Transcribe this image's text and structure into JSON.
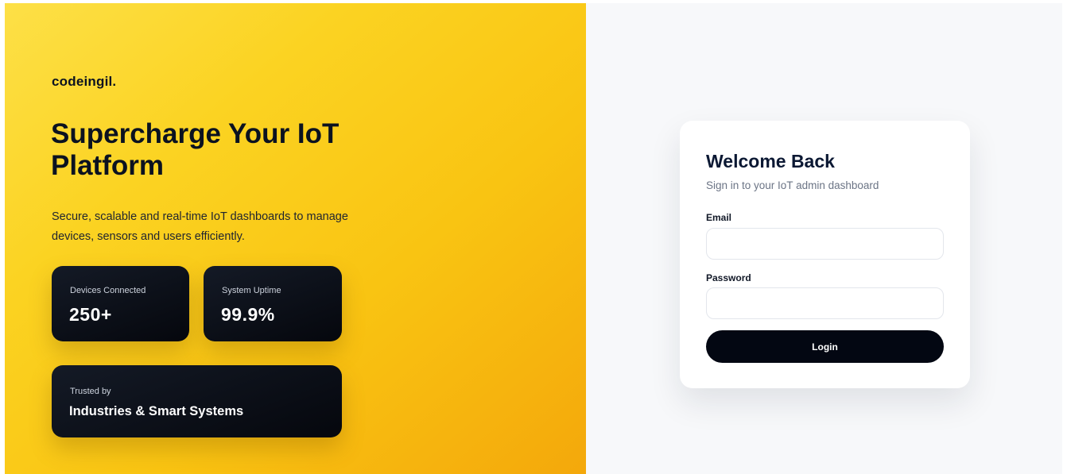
{
  "hero": {
    "brand": "codeingil.",
    "title": "Supercharge Your IoT Platform",
    "subtitle": "Secure, scalable and real-time IoT dashboards to manage devices, sensors and users efficiently.",
    "stats": [
      {
        "label": "Devices Connected",
        "value": "250+"
      },
      {
        "label": "System Uptime",
        "value": "99.9%"
      }
    ],
    "trusted": {
      "label": "Trusted by",
      "value": "Industries & Smart Systems"
    }
  },
  "login": {
    "title": "Welcome Back",
    "subtitle": "Sign in to your IoT admin dashboard",
    "email_label": "Email",
    "email_value": "",
    "email_placeholder": "",
    "password_label": "Password",
    "password_value": "",
    "password_placeholder": "",
    "button_label": "Login"
  },
  "colors": {
    "accent_yellow": "#fbd322",
    "accent_orange": "#f4a80b",
    "dark": "#030712",
    "background": "#f7f8fa"
  }
}
